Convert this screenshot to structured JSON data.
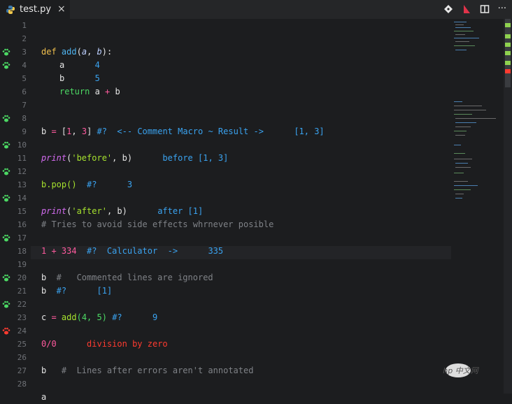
{
  "tab": {
    "filename": "test.py",
    "close_icon": "×"
  },
  "toolbar": {
    "icons": [
      "git-compare-icon",
      "debug-icon",
      "split-editor-icon",
      "more-icon"
    ],
    "more": "···"
  },
  "colors": {
    "green_gutter": "#4cd964",
    "red_gutter": "#ff3b30",
    "result": "#3aa3f0"
  },
  "lines": [
    {
      "n": "1"
    },
    {
      "n": "2"
    },
    {
      "n": "3"
    },
    {
      "n": "4"
    },
    {
      "n": "5"
    },
    {
      "n": "6"
    },
    {
      "n": "7"
    },
    {
      "n": "8"
    },
    {
      "n": "9"
    },
    {
      "n": "10"
    },
    {
      "n": "11"
    },
    {
      "n": "12"
    },
    {
      "n": "13"
    },
    {
      "n": "14"
    },
    {
      "n": "15"
    },
    {
      "n": "16"
    },
    {
      "n": "17"
    },
    {
      "n": "18"
    },
    {
      "n": "19"
    },
    {
      "n": "20"
    },
    {
      "n": "21"
    },
    {
      "n": "22"
    },
    {
      "n": "23"
    },
    {
      "n": "24"
    },
    {
      "n": "25"
    },
    {
      "n": "26"
    },
    {
      "n": "27"
    },
    {
      "n": "28"
    }
  ],
  "code": {
    "l2": {
      "def": "def",
      "name": "add",
      "open": "(",
      "a": "a",
      "comma": ", ",
      "b": "b",
      "close": "):"
    },
    "l3": {
      "var": "a",
      "val": "4"
    },
    "l4": {
      "var": "b",
      "val": "5"
    },
    "l5": {
      "ret": "return",
      "rest": " a ",
      "plus": "+",
      "b": " b"
    },
    "l8": {
      "b": "b",
      "eq": " = ",
      "lb": "[",
      "one": "1",
      "sep": ", ",
      "three": "3",
      "rb": "]",
      "macro": " #?  <-- Comment Macro ~ Result ->",
      "result": "[1, 3]"
    },
    "l10": {
      "fn": "print",
      "open": "(",
      "str": "'before'",
      "rest": ", b)",
      "result": "before [1, 3]"
    },
    "l12": {
      "code": "b.pop()",
      "macro": "  #?",
      "result": "3"
    },
    "l14": {
      "fn": "print",
      "open": "(",
      "str": "'after'",
      "rest": ", b)",
      "result": "after [1]"
    },
    "l15": {
      "comment": "# Tries to avoid side effects whrnever posible"
    },
    "l17": {
      "expr": "1 + 334",
      "macro": "  #?  Calculator  ->",
      "result": "335"
    },
    "l19": {
      "b": "b",
      "comment": "  #   Commented lines are ignored"
    },
    "l20": {
      "b": "b",
      "macro": "  #?",
      "result": "[1]"
    },
    "l22": {
      "c": "c",
      "eq": " = ",
      "fn": "add",
      "args": "(4, 5)",
      "macro": " #?",
      "result": "9"
    },
    "l24": {
      "expr": "0/0",
      "result": "division by zero"
    },
    "l26": {
      "b": "b",
      "comment": "   #  Lines after errors aren't annotated"
    },
    "l28": {
      "a": "a"
    }
  },
  "watermark": "php 中文网"
}
